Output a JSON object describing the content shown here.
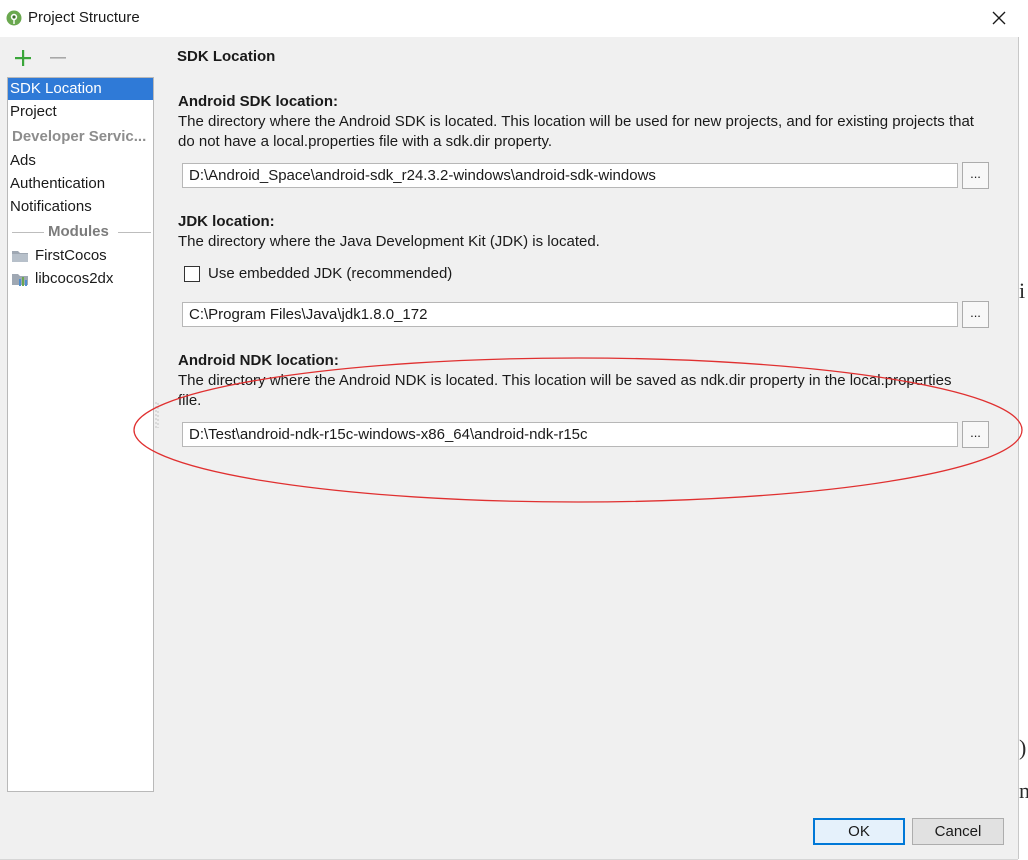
{
  "window": {
    "title": "Project Structure",
    "close_glyph": "✕"
  },
  "toolbar": {
    "add_glyph": "+",
    "remove_glyph": "−"
  },
  "sidebar": {
    "items": [
      {
        "label": "SDK Location",
        "selected": true
      },
      {
        "label": "Project",
        "selected": false
      }
    ],
    "developer_services_group": "Developer Servic...",
    "service_items": [
      "Ads",
      "Authentication",
      "Notifications"
    ],
    "modules_header": "Modules",
    "modules": [
      {
        "label": "FirstCocos",
        "icon": "folder-icon"
      },
      {
        "label": "libcocos2dx",
        "icon": "library-module-icon"
      }
    ]
  },
  "content": {
    "page_title": "SDK Location",
    "android_sdk": {
      "heading": "Android SDK location:",
      "description": "The directory where the Android SDK is located. This location will be used for new projects, and for existing projects that do not have a local.properties file with a sdk.dir property.",
      "path": "D:\\Android_Space\\android-sdk_r24.3.2-windows\\android-sdk-windows",
      "browse_label": "..."
    },
    "jdk": {
      "heading": "JDK location:",
      "description": "The directory where the Java Development Kit (JDK) is located.",
      "embedded_checkbox_label": "Use embedded JDK (recommended)",
      "embedded_checked": false,
      "path": "C:\\Program Files\\Java\\jdk1.8.0_172",
      "browse_label": "..."
    },
    "android_ndk": {
      "heading": "Android NDK location:",
      "description": "The directory where the Android NDK is located. This location will be saved as ndk.dir property in the local.properties file.",
      "path": "D:\\Test\\android-ndk-r15c-windows-x86_64\\android-ndk-r15c",
      "browse_label": "..."
    }
  },
  "footer": {
    "ok_label": "OK",
    "cancel_label": "Cancel"
  },
  "background_window_glyphs": [
    "i",
    ")",
    "n"
  ],
  "colors": {
    "selection": "#2f7ad7",
    "add_icon": "#3aa63a",
    "annotation": "#e03030",
    "ok_border": "#0078d7"
  }
}
